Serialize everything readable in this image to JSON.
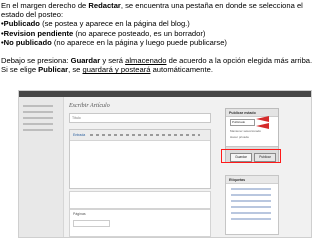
{
  "instructions": {
    "para1_prefix": "En el margen derecho de ",
    "para1_bold": "Redactar",
    "para1_suffix": ", se encuentra una pestaña en donde se selecciona el estado del posteo:",
    "b1_bold": "•Publicado",
    "b1_text": " (se postea y aparece en la página del blog.)",
    "b2_bold": "•Revision pendiente",
    "b2_text": " (no aparece posteado, es un borrador)",
    "b3_bold": "•No publicado",
    "b3_text": " (no aparece en la página y luego puede publicarse)",
    "para2_t1": "Debajo se presiona: ",
    "para2_b1": "Guardar",
    "para2_t2": " y será ",
    "para2_u1": "almacenado",
    "para2_t3": " de acuerdo a la opción elegida más arriba.",
    "para3_t1": "Si se elige ",
    "para3_b1": "Publicar",
    "para3_t2": ", se ",
    "para3_u1": "guardará y posteará",
    "para3_t3": " automáticamente."
  },
  "screenshot": {
    "page_heading": "Escribir Artículo",
    "title_label": "Título",
    "editor_tab": "Entrada",
    "publish_panel": {
      "title": "Publicar estado",
      "status_value": "Publicado",
      "row1": "Mantener seleccionado",
      "row2": "Hacer privada",
      "save_label": "Guardar",
      "publish_label": "Publicar"
    },
    "tags_panel": {
      "title": "Etiquetas"
    },
    "pages_label": "Páginas"
  }
}
